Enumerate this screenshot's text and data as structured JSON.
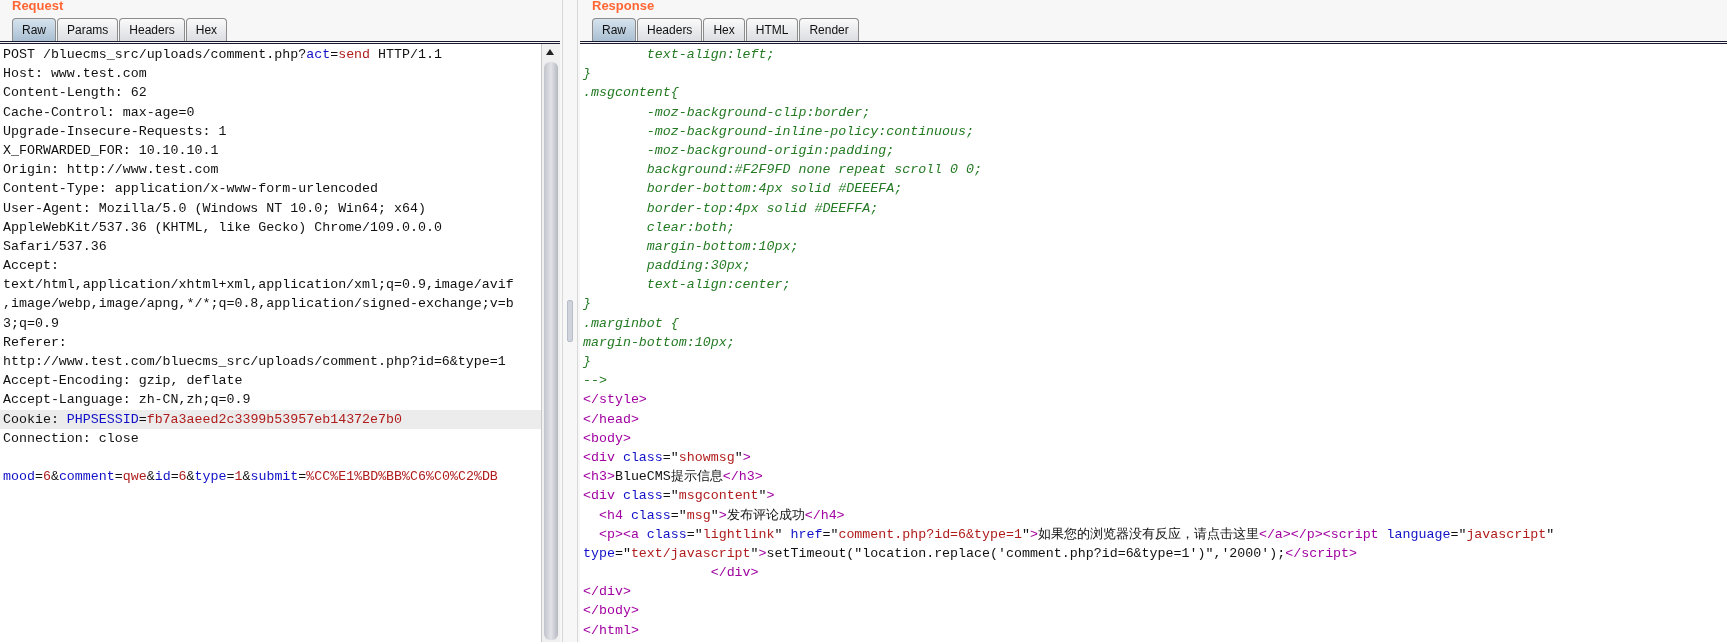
{
  "request": {
    "title": "Request",
    "tabs": [
      {
        "label": "Raw",
        "selected": true
      },
      {
        "label": "Params",
        "selected": false
      },
      {
        "label": "Headers",
        "selected": false
      },
      {
        "label": "Hex",
        "selected": false
      }
    ],
    "lines": [
      {
        "highlighted": false,
        "segments": [
          {
            "kind": "plain",
            "text": "POST /bluecms_src/uploads/comment.php?"
          },
          {
            "kind": "name",
            "text": "act"
          },
          {
            "kind": "plain",
            "text": "="
          },
          {
            "kind": "value",
            "text": "send"
          },
          {
            "kind": "plain",
            "text": " HTTP/1.1"
          }
        ]
      },
      {
        "highlighted": false,
        "segments": [
          {
            "kind": "plain",
            "text": "Host: www.test.com"
          }
        ]
      },
      {
        "highlighted": false,
        "segments": [
          {
            "kind": "plain",
            "text": "Content-Length: 62"
          }
        ]
      },
      {
        "highlighted": false,
        "segments": [
          {
            "kind": "plain",
            "text": "Cache-Control: max-age=0"
          }
        ]
      },
      {
        "highlighted": false,
        "segments": [
          {
            "kind": "plain",
            "text": "Upgrade-Insecure-Requests: 1"
          }
        ]
      },
      {
        "highlighted": false,
        "segments": [
          {
            "kind": "plain",
            "text": "X_FORWARDED_FOR: 10.10.10.1"
          }
        ]
      },
      {
        "highlighted": false,
        "segments": [
          {
            "kind": "plain",
            "text": "Origin: http://www.test.com"
          }
        ]
      },
      {
        "highlighted": false,
        "segments": [
          {
            "kind": "plain",
            "text": "Content-Type: application/x-www-form-urlencoded"
          }
        ]
      },
      {
        "highlighted": false,
        "segments": [
          {
            "kind": "plain",
            "text": "User-Agent: Mozilla/5.0 (Windows NT 10.0; Win64; x64)"
          }
        ]
      },
      {
        "highlighted": false,
        "segments": [
          {
            "kind": "plain",
            "text": "AppleWebKit/537.36 (KHTML, like Gecko) Chrome/109.0.0.0"
          }
        ]
      },
      {
        "highlighted": false,
        "segments": [
          {
            "kind": "plain",
            "text": "Safari/537.36"
          }
        ]
      },
      {
        "highlighted": false,
        "segments": [
          {
            "kind": "plain",
            "text": "Accept:"
          }
        ]
      },
      {
        "highlighted": false,
        "segments": [
          {
            "kind": "plain",
            "text": "text/html,application/xhtml+xml,application/xml;q=0.9,image/avif"
          }
        ]
      },
      {
        "highlighted": false,
        "segments": [
          {
            "kind": "plain",
            "text": ",image/webp,image/apng,*/*;q=0.8,application/signed-exchange;v=b"
          }
        ]
      },
      {
        "highlighted": false,
        "segments": [
          {
            "kind": "plain",
            "text": "3;q=0.9"
          }
        ]
      },
      {
        "highlighted": false,
        "segments": [
          {
            "kind": "plain",
            "text": "Referer:"
          }
        ]
      },
      {
        "highlighted": false,
        "segments": [
          {
            "kind": "plain",
            "text": "http://www.test.com/bluecms_src/uploads/comment.php?id=6&type=1"
          }
        ]
      },
      {
        "highlighted": false,
        "segments": [
          {
            "kind": "plain",
            "text": "Accept-Encoding: gzip, deflate"
          }
        ]
      },
      {
        "highlighted": false,
        "segments": [
          {
            "kind": "plain",
            "text": "Accept-Language: zh-CN,zh;q=0.9"
          }
        ]
      },
      {
        "highlighted": true,
        "segments": [
          {
            "kind": "plain",
            "text": "Cookie: "
          },
          {
            "kind": "name",
            "text": "PHPSESSID"
          },
          {
            "kind": "plain",
            "text": "="
          },
          {
            "kind": "value",
            "text": "fb7a3aeed2c3399b53957eb14372e7b0"
          }
        ]
      },
      {
        "highlighted": false,
        "segments": [
          {
            "kind": "plain",
            "text": "Connection: close"
          }
        ]
      },
      {
        "highlighted": false
      },
      {
        "highlighted": false,
        "segments": [
          {
            "kind": "name",
            "text": "mood"
          },
          {
            "kind": "plain",
            "text": "="
          },
          {
            "kind": "value",
            "text": "6"
          },
          {
            "kind": "plain",
            "text": "&"
          },
          {
            "kind": "name",
            "text": "comment"
          },
          {
            "kind": "plain",
            "text": "="
          },
          {
            "kind": "value",
            "text": "qwe"
          },
          {
            "kind": "plain",
            "text": "&"
          },
          {
            "kind": "name",
            "text": "id"
          },
          {
            "kind": "plain",
            "text": "="
          },
          {
            "kind": "value",
            "text": "6"
          },
          {
            "kind": "plain",
            "text": "&"
          },
          {
            "kind": "name",
            "text": "type"
          },
          {
            "kind": "plain",
            "text": "="
          },
          {
            "kind": "value",
            "text": "1"
          },
          {
            "kind": "plain",
            "text": "&"
          },
          {
            "kind": "name",
            "text": "submit"
          },
          {
            "kind": "plain",
            "text": "="
          },
          {
            "kind": "value",
            "text": "%CC%E1%BD%BB%C6%C0%C2%DB"
          }
        ]
      }
    ]
  },
  "response": {
    "title": "Response",
    "tabs": [
      {
        "label": "Raw",
        "selected": true
      },
      {
        "label": "Headers",
        "selected": false
      },
      {
        "label": "Hex",
        "selected": false
      },
      {
        "label": "HTML",
        "selected": false
      },
      {
        "label": "Render",
        "selected": false
      }
    ],
    "lines": [
      [
        {
          "kind": "css",
          "text": "        text-align:left;"
        }
      ],
      [
        {
          "kind": "css",
          "text": "}"
        }
      ],
      [
        {
          "kind": "css",
          "text": ".msgcontent{"
        }
      ],
      [
        {
          "kind": "css",
          "text": "        -moz-background-clip:border;"
        }
      ],
      [
        {
          "kind": "css",
          "text": "        -moz-background-inline-policy:continuous;"
        }
      ],
      [
        {
          "kind": "css",
          "text": "        -moz-background-origin:padding;"
        }
      ],
      [
        {
          "kind": "css",
          "text": "        background:#F2F9FD none repeat scroll 0 0;"
        }
      ],
      [
        {
          "kind": "css",
          "text": "        border-bottom:4px solid #DEEEFA;"
        }
      ],
      [
        {
          "kind": "css",
          "text": "        border-top:4px solid #DEEFFA;"
        }
      ],
      [
        {
          "kind": "css",
          "text": "        clear:both;"
        }
      ],
      [
        {
          "kind": "css",
          "text": "        margin-bottom:10px;"
        }
      ],
      [
        {
          "kind": "css",
          "text": "        padding:30px;"
        }
      ],
      [
        {
          "kind": "css",
          "text": "        text-align:center;"
        }
      ],
      [
        {
          "kind": "css",
          "text": "}"
        }
      ],
      [
        {
          "kind": "css",
          "text": ".marginbot {"
        }
      ],
      [
        {
          "kind": "css",
          "text": "margin-bottom:10px;"
        }
      ],
      [
        {
          "kind": "css",
          "text": "}"
        }
      ],
      [
        {
          "kind": "css",
          "text": "-->"
        }
      ],
      [
        {
          "kind": "tag",
          "text": "</style>"
        }
      ],
      [
        {
          "kind": "tag",
          "text": "</head>"
        }
      ],
      [
        {
          "kind": "tag",
          "text": "<body>"
        }
      ],
      [
        {
          "kind": "tag",
          "text": "<div "
        },
        {
          "kind": "name",
          "text": "class"
        },
        {
          "kind": "plain",
          "text": "=\""
        },
        {
          "kind": "value",
          "text": "showmsg"
        },
        {
          "kind": "plain",
          "text": "\""
        },
        {
          "kind": "tag",
          "text": ">"
        }
      ],
      [
        {
          "kind": "tag",
          "text": "<h3>"
        },
        {
          "kind": "plain",
          "text": "BlueCMS提示信息"
        },
        {
          "kind": "tag",
          "text": "</h3>"
        }
      ],
      [
        {
          "kind": "tag",
          "text": "<div "
        },
        {
          "kind": "name",
          "text": "class"
        },
        {
          "kind": "plain",
          "text": "=\""
        },
        {
          "kind": "value",
          "text": "msgcontent"
        },
        {
          "kind": "plain",
          "text": "\""
        },
        {
          "kind": "tag",
          "text": ">"
        }
      ],
      [
        {
          "kind": "tag",
          "text": "  <h4 "
        },
        {
          "kind": "name",
          "text": "class"
        },
        {
          "kind": "plain",
          "text": "=\""
        },
        {
          "kind": "value",
          "text": "msg"
        },
        {
          "kind": "plain",
          "text": "\""
        },
        {
          "kind": "tag",
          "text": ">"
        },
        {
          "kind": "plain",
          "text": "发布评论成功"
        },
        {
          "kind": "tag",
          "text": "</h4>"
        }
      ],
      [
        {
          "kind": "tag",
          "text": "  <p><a "
        },
        {
          "kind": "name",
          "text": "class"
        },
        {
          "kind": "plain",
          "text": "=\""
        },
        {
          "kind": "value",
          "text": "lightlink"
        },
        {
          "kind": "plain",
          "text": "\" "
        },
        {
          "kind": "name",
          "text": "href"
        },
        {
          "kind": "plain",
          "text": "=\""
        },
        {
          "kind": "value",
          "text": "comment.php?id=6&type=1"
        },
        {
          "kind": "plain",
          "text": "\""
        },
        {
          "kind": "tag",
          "text": ">"
        },
        {
          "kind": "plain",
          "text": "如果您的浏览器没有反应，请点击这里"
        },
        {
          "kind": "tag",
          "text": "</a></p><script "
        },
        {
          "kind": "name",
          "text": "language"
        },
        {
          "kind": "plain",
          "text": "=\""
        },
        {
          "kind": "value",
          "text": "javascript"
        },
        {
          "kind": "plain",
          "text": "\""
        }
      ],
      [
        {
          "kind": "name",
          "text": "type"
        },
        {
          "kind": "plain",
          "text": "=\""
        },
        {
          "kind": "value",
          "text": "text/javascript"
        },
        {
          "kind": "plain",
          "text": "\""
        },
        {
          "kind": "tag",
          "text": ">"
        },
        {
          "kind": "plain",
          "text": "setTimeout(\"location.replace('comment.php?id=6&type=1')\",'2000');"
        },
        {
          "kind": "tag",
          "text": "</script>"
        }
      ],
      [
        {
          "kind": "tag",
          "text": "                </div>"
        }
      ],
      [
        {
          "kind": "tag",
          "text": "</div>"
        }
      ],
      [
        {
          "kind": "tag",
          "text": "</body>"
        }
      ],
      [
        {
          "kind": "tag",
          "text": "</html>"
        }
      ]
    ]
  }
}
